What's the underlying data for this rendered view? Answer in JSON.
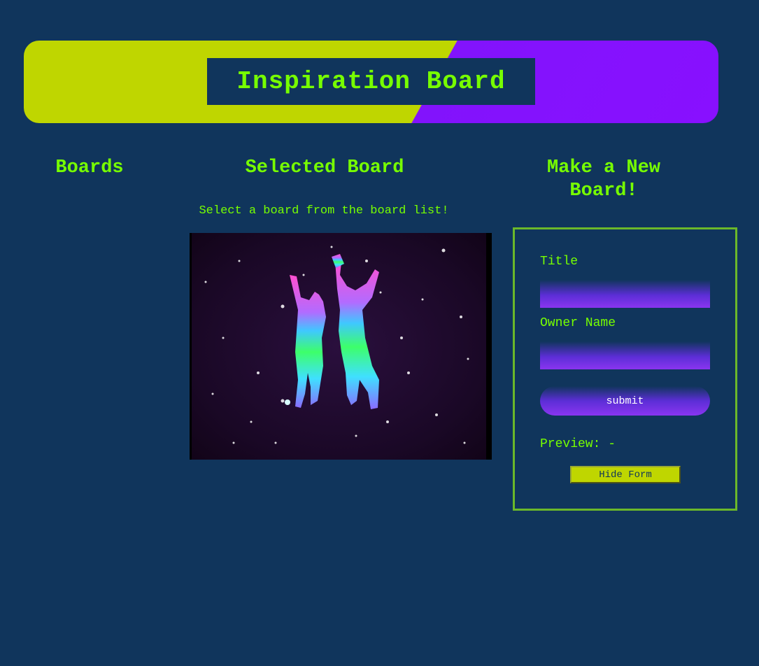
{
  "header": {
    "title": "Inspiration Board"
  },
  "columns": {
    "boards_heading": "Boards",
    "selected_heading": "Selected Board",
    "new_board_heading": "Make a New Board!"
  },
  "selected_board": {
    "hint": "Select a board from the board list!",
    "image_alt": "dancing-silhouettes-gif"
  },
  "new_board_form": {
    "title_label": "Title",
    "title_value": "",
    "owner_label": "Owner Name",
    "owner_value": "",
    "submit_label": "submit",
    "preview_label": "Preview: -",
    "hide_button_label": "Hide Form"
  },
  "colors": {
    "background": "#10355c",
    "accent_green": "#77ff00",
    "banner_yellow": "#bfd600",
    "banner_purple": "#8810ff",
    "panel_border": "#6bb82a"
  }
}
